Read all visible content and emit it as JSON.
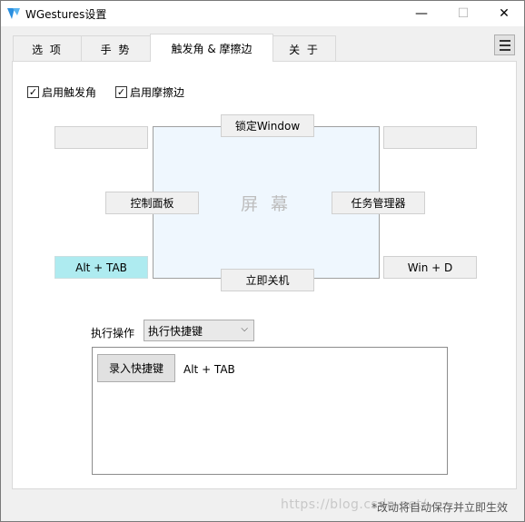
{
  "window": {
    "title": "WGestures设置",
    "controls": {
      "minimize": "—",
      "maximize": "☐",
      "close": "✕"
    }
  },
  "tabs": [
    {
      "label": "选 项",
      "active": false
    },
    {
      "label": "手 势",
      "active": false
    },
    {
      "label": "触发角 & 摩擦边",
      "active": true
    },
    {
      "label": "关 于",
      "active": false
    }
  ],
  "menu_icon": "hamburger-menu-icon",
  "options": {
    "enable_corners": {
      "label": "启用触发角",
      "checked": true
    },
    "enable_edges": {
      "label": "启用摩擦边",
      "checked": true
    }
  },
  "screen": {
    "label": "屏 幕"
  },
  "gestures": {
    "top_edge": "锁定Window",
    "bottom_edge": "立即关机",
    "left_edge": "控制面板",
    "right_edge": "任务管理器",
    "top_left_corner": "",
    "top_right_corner": "",
    "bottom_left_corner": "Alt + TAB",
    "bottom_right_corner": "Win + D"
  },
  "action": {
    "label": "执行操作",
    "selected": "执行快捷键",
    "record_button": "录入快捷键",
    "hotkey": "Alt + TAB"
  },
  "footer": {
    "note": "*改动将自动保存并立即生效",
    "watermark": "https://blog.csdn.net/"
  },
  "colors": {
    "screen_bg": "#eff7fe",
    "selected_corner": "#aeebf0",
    "panel_bg": "#ffffff"
  }
}
